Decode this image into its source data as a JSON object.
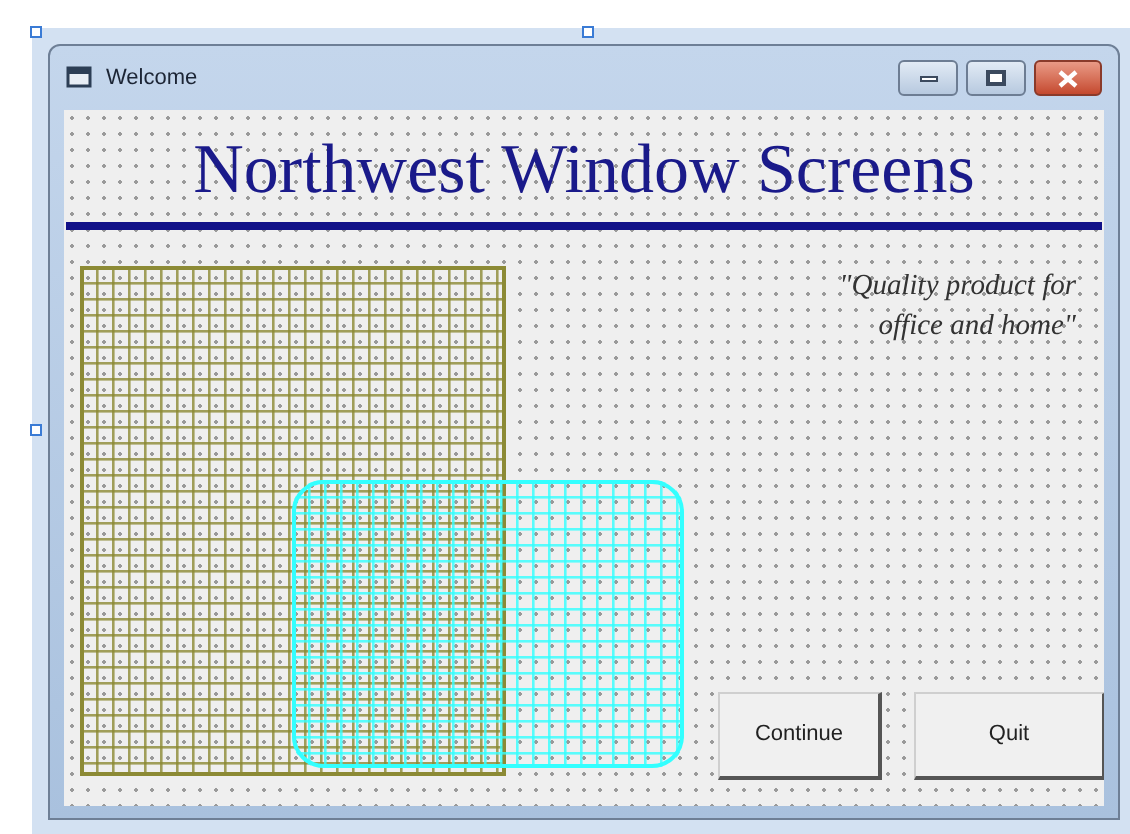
{
  "window": {
    "title": "Welcome"
  },
  "heading": "Northwest Window Screens",
  "tagline": [
    "\"Quality product for",
    "office and home\""
  ],
  "shapes": [
    {
      "kind": "rectangle",
      "color": "#8c8a35"
    },
    {
      "kind": "rounded_rectangle",
      "color": "#33ffff"
    }
  ],
  "buttons": [
    "Continue",
    "Quit"
  ]
}
